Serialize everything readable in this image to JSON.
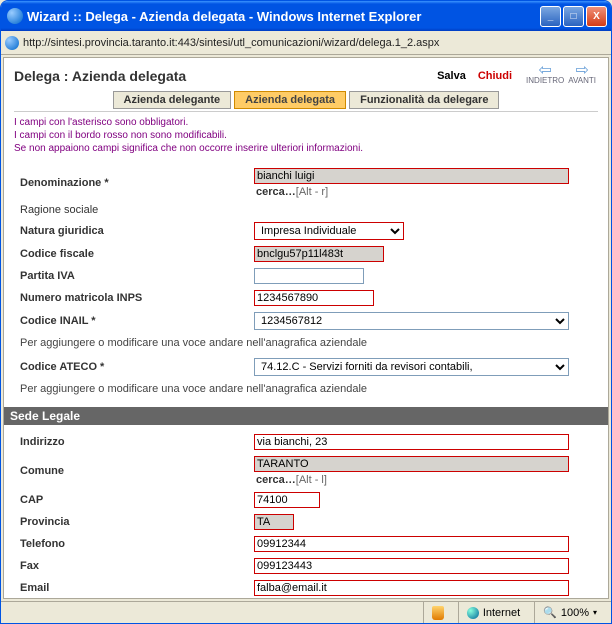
{
  "window": {
    "title": "Wizard :: Delega - Azienda delegata - Windows Internet Explorer",
    "url": "http://sintesi.provincia.taranto.it:443/sintesi/utl_comunicazioni/wizard/delega.1_2.aspx"
  },
  "header": {
    "title": "Delega : Azienda delegata",
    "salva": "Salva",
    "chiudi": "Chiudi",
    "indietro": "INDIETRO",
    "avanti": "AVANTI"
  },
  "tabs": {
    "t1": "Azienda delegante",
    "t2": "Azienda delegata",
    "t3": "Funzionalità da delegare"
  },
  "hints": {
    "l1": "I campi con l'asterisco sono obbligatori.",
    "l2": "I campi con il bordo rosso non sono modificabili.",
    "l3": "Se non appaiono campi significa che non occorre inserire ulteriori informazioni."
  },
  "form": {
    "denominazione_label": "Denominazione *",
    "denominazione_value": "bianchi luigi",
    "cerca_prefix": "cerca…",
    "cerca_r": "[Alt - r]",
    "ragione_label": "Ragione sociale",
    "natura_label": "Natura giuridica",
    "natura_value": "Impresa Individuale",
    "cf_label": "Codice fiscale",
    "cf_value": "bnclgu57p11l483t",
    "piva_label": "Partita IVA",
    "piva_value": "",
    "inps_label": "Numero matricola INPS",
    "inps_value": "1234567890",
    "inail_label": "Codice INAIL *",
    "inail_value": "1234567812",
    "note_anag": "Per aggiungere o modificare una voce andare nell'anagrafica aziendale",
    "ateco_label": "Codice ATECO *",
    "ateco_value": "74.12.C - Servizi forniti da revisori contabili,",
    "sede_legale": "Sede Legale",
    "indirizzo_label": "Indirizzo",
    "indirizzo_value": "via bianchi, 23",
    "comune_label": "Comune",
    "comune_value": "TARANTO",
    "cerca_l": "[Alt - l]",
    "cap_label": "CAP",
    "cap_value": "74100",
    "provincia_label": "Provincia",
    "provincia_value": "TA",
    "telefono_label": "Telefono",
    "telefono_value": "09912344",
    "fax_label": "Fax",
    "fax_value": "099123443",
    "email_label": "Email",
    "email_value": "falba@email.it"
  },
  "status": {
    "zone": "Internet",
    "zoom": "100%"
  }
}
